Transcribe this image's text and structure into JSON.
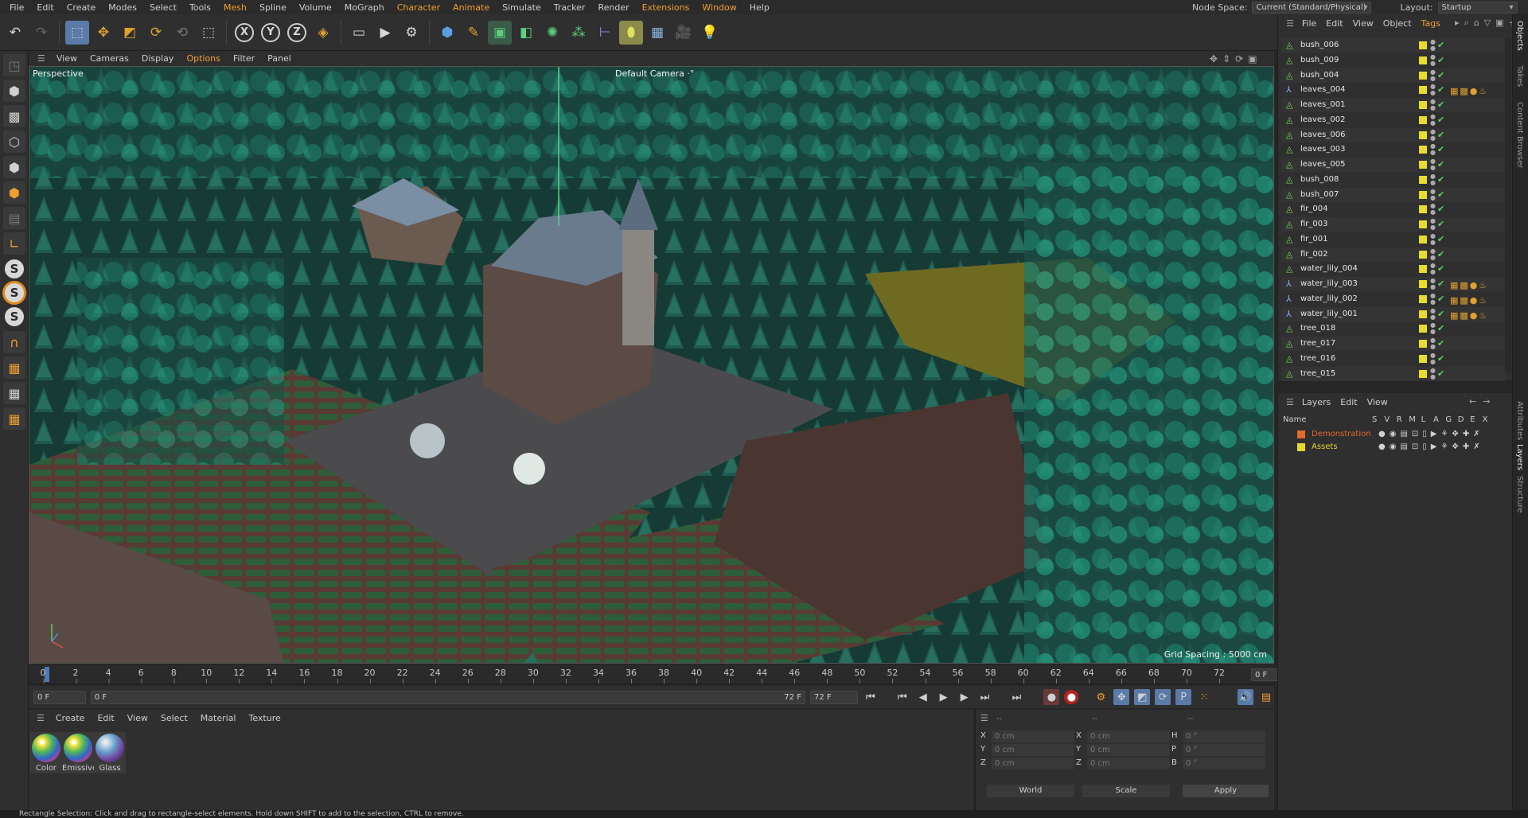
{
  "menu": [
    "File",
    "Edit",
    "Create",
    "Modes",
    "Select",
    "Tools",
    "Mesh",
    "Spline",
    "Volume",
    "MoGraph",
    "Character",
    "Animate",
    "Simulate",
    "Tracker",
    "Render",
    "Extensions",
    "Window",
    "Help"
  ],
  "highlight_menu": [
    "Mesh",
    "Character",
    "Animate",
    "Extensions",
    "Window"
  ],
  "node_space": {
    "label": "Node Space:",
    "value": "Current (Standard/Physical)"
  },
  "layout": {
    "label": "Layout:",
    "value": "Startup"
  },
  "viewport": {
    "menu": [
      "View",
      "Cameras",
      "Display",
      "Options",
      "Filter",
      "Panel"
    ],
    "highlight": "Options",
    "label": "Perspective",
    "camera": "Default Camera ·°",
    "grid": "Grid Spacing : 5000 cm"
  },
  "timeline": {
    "ticks": [
      "0",
      "2",
      "4",
      "6",
      "8",
      "10",
      "12",
      "14",
      "16",
      "18",
      "20",
      "22",
      "24",
      "26",
      "28",
      "30",
      "32",
      "34",
      "36",
      "38",
      "40",
      "42",
      "44",
      "46",
      "48",
      "50",
      "52",
      "54",
      "56",
      "58",
      "60",
      "62",
      "64",
      "66",
      "68",
      "70",
      "72"
    ],
    "current": "0 F"
  },
  "range": {
    "start": "0 F",
    "range_start": "0 F",
    "range_end": "72 F",
    "end": "72 F"
  },
  "material": {
    "menu": [
      "Create",
      "Edit",
      "View",
      "Select",
      "Material",
      "Texture"
    ],
    "items": [
      {
        "name": "Color"
      },
      {
        "name": "Emissive"
      },
      {
        "name": "Glass"
      }
    ]
  },
  "coords": {
    "headers": [
      "--",
      "--",
      "--"
    ],
    "rows": [
      {
        "a": "X",
        "av": "0 cm",
        "b": "X",
        "bv": "0 cm",
        "c": "H",
        "cv": "0 °"
      },
      {
        "a": "Y",
        "av": "0 cm",
        "b": "Y",
        "bv": "0 cm",
        "c": "P",
        "cv": "0 °"
      },
      {
        "a": "Z",
        "av": "0 cm",
        "b": "Z",
        "bv": "0 cm",
        "c": "B",
        "cv": "0 °"
      }
    ],
    "world": "World",
    "scale": "Scale",
    "apply": "Apply"
  },
  "objects": {
    "menu": [
      "File",
      "Edit",
      "View",
      "Object",
      "Tags"
    ],
    "highlight": "Tags",
    "items": [
      {
        "name": "bush_006",
        "kind": "green",
        "tags": ""
      },
      {
        "name": "bush_009",
        "kind": "green",
        "tags": ""
      },
      {
        "name": "bush_004",
        "kind": "green",
        "tags": ""
      },
      {
        "name": "leaves_004",
        "kind": "blue",
        "tags": "▦▩●♨"
      },
      {
        "name": "leaves_001",
        "kind": "green",
        "tags": ""
      },
      {
        "name": "leaves_002",
        "kind": "green",
        "tags": ""
      },
      {
        "name": "leaves_006",
        "kind": "green",
        "tags": ""
      },
      {
        "name": "leaves_003",
        "kind": "green",
        "tags": ""
      },
      {
        "name": "leaves_005",
        "kind": "green",
        "tags": ""
      },
      {
        "name": "bush_008",
        "kind": "green",
        "tags": ""
      },
      {
        "name": "bush_007",
        "kind": "green",
        "tags": ""
      },
      {
        "name": "fir_004",
        "kind": "green",
        "tags": ""
      },
      {
        "name": "fir_003",
        "kind": "green",
        "tags": ""
      },
      {
        "name": "fir_001",
        "kind": "green",
        "tags": ""
      },
      {
        "name": "fir_002",
        "kind": "green",
        "tags": ""
      },
      {
        "name": "water_lily_004",
        "kind": "green",
        "tags": ""
      },
      {
        "name": "water_lily_003",
        "kind": "blue",
        "tags": "▦▩●♨"
      },
      {
        "name": "water_lily_002",
        "kind": "blue",
        "tags": "▦▩●♨"
      },
      {
        "name": "water_lily_001",
        "kind": "blue",
        "tags": "▦▩●♨"
      },
      {
        "name": "tree_018",
        "kind": "green",
        "tags": ""
      },
      {
        "name": "tree_017",
        "kind": "green",
        "tags": ""
      },
      {
        "name": "tree_016",
        "kind": "green",
        "tags": ""
      },
      {
        "name": "tree_015",
        "kind": "green",
        "tags": ""
      }
    ]
  },
  "layers": {
    "menu": [
      "Layers",
      "Edit",
      "View"
    ],
    "columns": [
      "Name",
      "S",
      "V",
      "R",
      "M",
      "L",
      "A",
      "G",
      "D",
      "E",
      "X"
    ],
    "items": [
      {
        "name": "Demonstration",
        "color": "#e06a2a"
      },
      {
        "name": "Assets",
        "color": "#e6d62e"
      }
    ]
  },
  "side_tabs": [
    "Objects",
    "Takes",
    "Content Browser",
    "Attributes",
    "Layers",
    "Structure"
  ],
  "status": "Rectangle Selection: Click and drag to rectangle-select elements. Hold down SHIFT to add to the selection, CTRL to remove."
}
